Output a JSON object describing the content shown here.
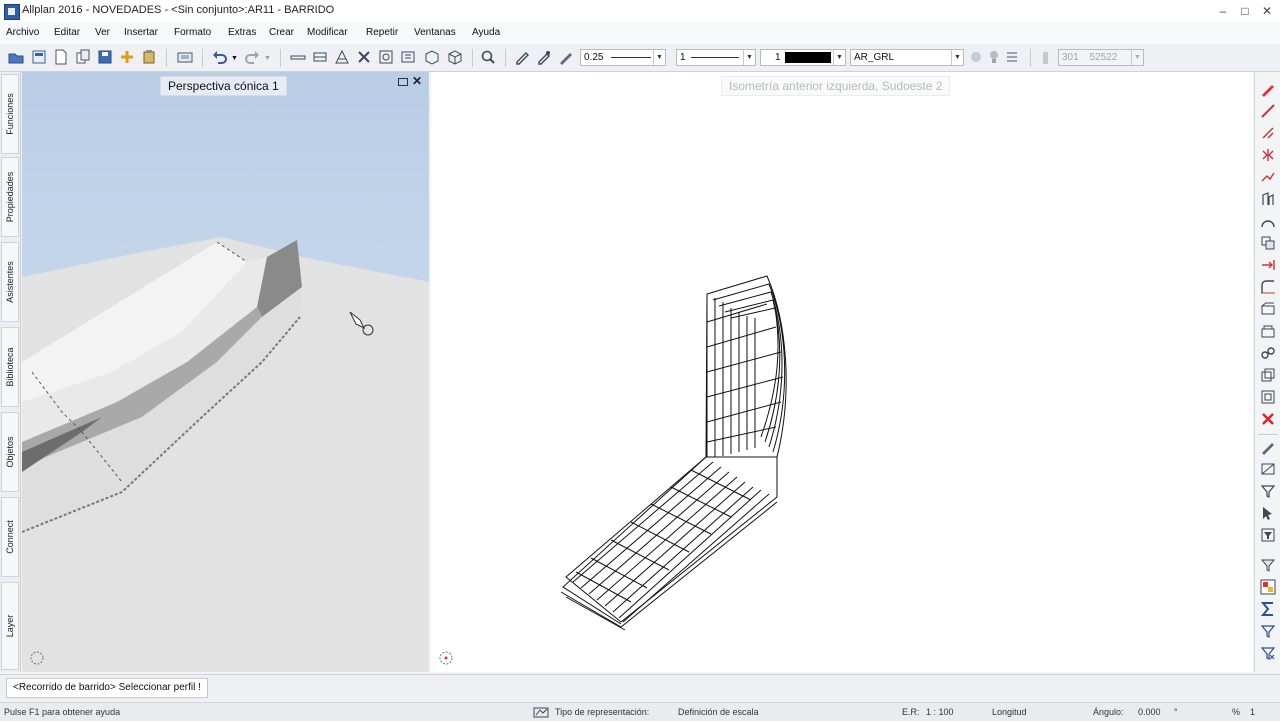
{
  "window": {
    "title": "Allplan 2016 - NOVEDADES - <Sin conjunto>:AR11 - BARRIDO",
    "minimize_icon": "minimize-icon",
    "maximize_icon": "maximize-icon",
    "close_icon": "close-icon"
  },
  "menu": {
    "items": [
      {
        "label": "Archivo"
      },
      {
        "label": "Editar"
      },
      {
        "label": "Ver"
      },
      {
        "label": "Insertar"
      },
      {
        "label": "Formato"
      },
      {
        "label": "Extras"
      },
      {
        "label": "Crear"
      },
      {
        "label": "Modificar"
      },
      {
        "label": "Repetir"
      },
      {
        "label": "Ventanas"
      },
      {
        "label": "Ayuda"
      }
    ]
  },
  "toolbar": {
    "pen_thickness": "0.25",
    "line_type": "1",
    "color_number": "1",
    "color_swatch": "#000000",
    "layer": "AR_GRL",
    "misc_a": "301",
    "misc_b": "52522"
  },
  "side_tabs": [
    "Funciones",
    "Propiedades",
    "Asistentes",
    "Biblioteca",
    "Objetos",
    "Connect",
    "Layer"
  ],
  "viewports": {
    "left": {
      "label": "Perspectiva cónica 1",
      "sky_color": "#bdd0e8",
      "ground_color": "#e2e2e2"
    },
    "right": {
      "label": "Isometría anterior izquierda, Sudoeste 2"
    }
  },
  "prompt": {
    "text": "<Recorrido de barrido> Seleccionar perfil !"
  },
  "status": {
    "help": "Pulse F1 para obtener ayuda",
    "representation_label": "Tipo de representación:",
    "representation_value": "Definición de escala",
    "scale_label": "E.R:",
    "scale_value": "1 : 100",
    "length_label": "Longitud",
    "angle_label": "Ángulo:",
    "angle_value": "0.000",
    "unit": "°",
    "percent": "%",
    "percent_value": "1"
  }
}
